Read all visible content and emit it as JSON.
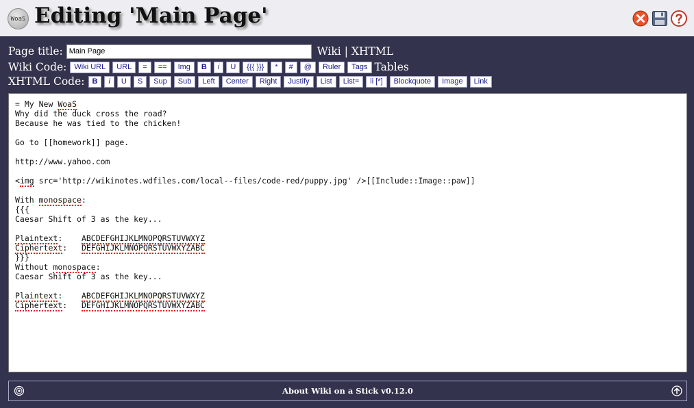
{
  "header": {
    "logo_text": "WoaS",
    "title": "Editing 'Main Page'",
    "icons": [
      "close-icon",
      "save-icon",
      "help-icon"
    ]
  },
  "toolbar": {
    "page_title_label": "Page title:",
    "page_title_value": "Main Page",
    "mode_wiki": "Wiki",
    "mode_sep": "|",
    "mode_xhtml": "XHTML",
    "wiki_code_label": "Wiki Code:",
    "wiki_buttons": [
      "Wiki URL",
      "URL",
      "=",
      "==",
      "Img",
      "B",
      "i",
      "U",
      "{{{ }}}",
      "*",
      "#",
      "@",
      "Ruler",
      "Tags"
    ],
    "tables_label": "Tables",
    "xhtml_code_label": "XHTML Code:",
    "xhtml_buttons": [
      "B",
      "i",
      "U",
      "S",
      "Sup",
      "Sub",
      "Left",
      "Center",
      "Right",
      "Justify",
      "List",
      "List=",
      "li [*]",
      "Blockquote",
      "Image",
      "Link"
    ]
  },
  "editor": {
    "lines": [
      "= My New WoaS",
      "Why did the duck cross the road?",
      "Because he was tied to the chicken!",
      "",
      "Go to [[homework]] page.",
      "",
      "http://www.yahoo.com",
      "",
      "<img src='http://wikinotes.wdfiles.com/local--files/code-red/puppy.jpg' />[[Include::Image::paw]]",
      "",
      "With monospace:",
      "{{{",
      "Caesar Shift of 3 as the key...",
      "",
      "Plaintext:    ABCDEFGHIJKLMNOPQRSTUVWXYZ",
      "Ciphertext:   DEFGHIJKLMNOPQRSTUVWXYZABC",
      "}}}",
      "Without monospace:",
      "Caesar Shift of 3 as the key...",
      "",
      "Plaintext:    ABCDEFGHIJKLMNOPQRSTUVWXYZ",
      "Ciphertext:   DEFGHIJKLMNOPQRSTUVWXYZABC"
    ],
    "misspelled": [
      "WoaS",
      "img",
      "monospace",
      "Plaintext",
      "Ciphertext",
      "ABCDEFGHIJKLMNOPQRSTUVWXYZ",
      "DEFGHIJKLMNOPQRSTUVWXYZABC"
    ]
  },
  "footer": {
    "about_text": "About Wiki on a Stick v0.12.0",
    "left_icon": "settings-icon",
    "right_icon": "scroll-up-icon"
  },
  "colors": {
    "background": "#33334d",
    "header_bg": "#eeeef2",
    "button_text": "#1a1a8c",
    "close_red": "#e8542a",
    "spell_underline": "#e02020"
  }
}
